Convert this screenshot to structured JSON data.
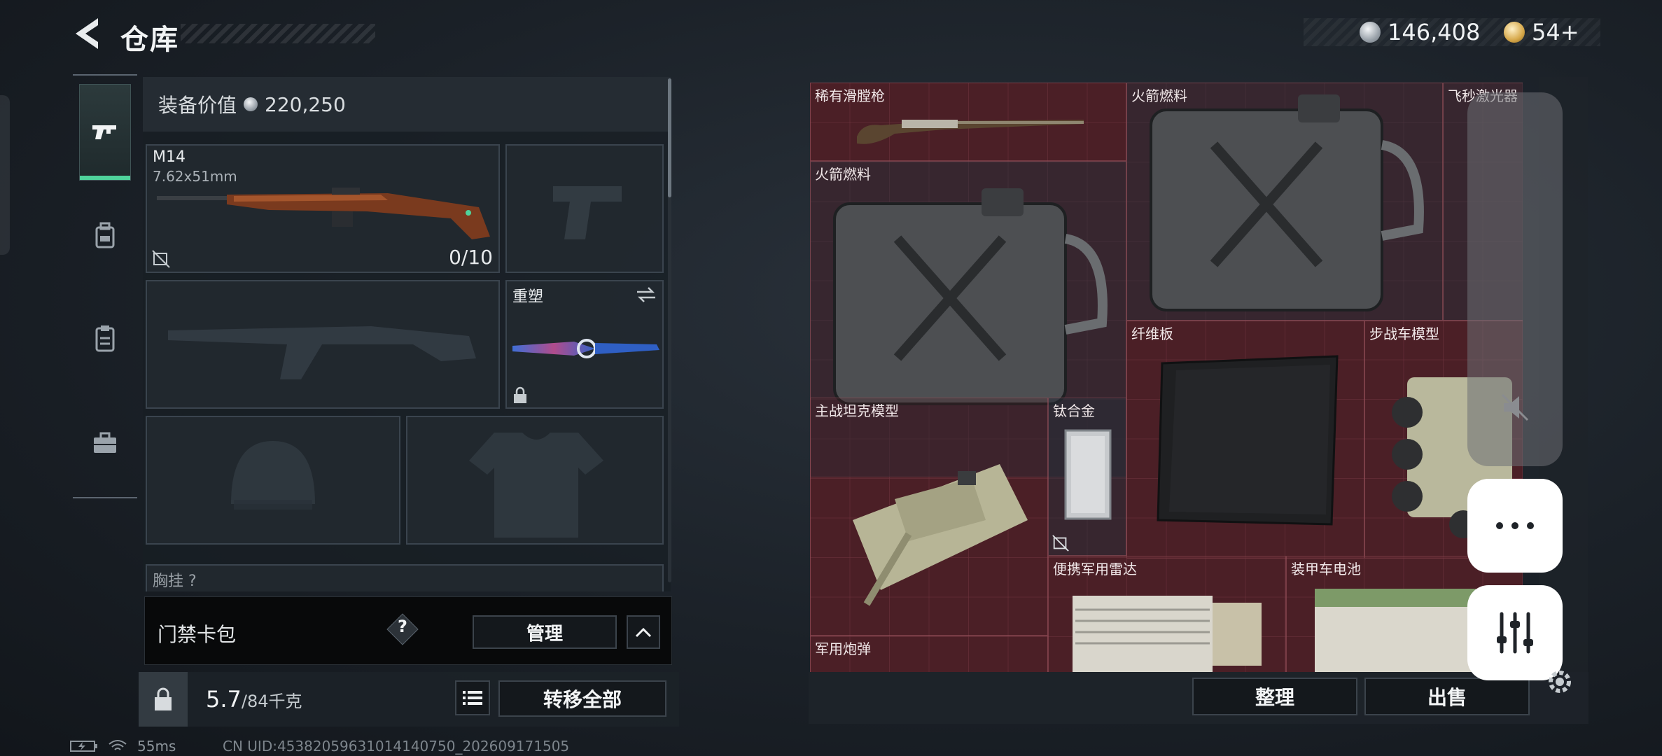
{
  "header": {
    "title": "仓库",
    "currencies": [
      {
        "icon": "silver-coin-icon",
        "amount": "146,408"
      },
      {
        "icon": "gold-coin-icon",
        "amount": "54+"
      }
    ]
  },
  "nav": {
    "items": [
      {
        "name": "weapons",
        "icon": "pistol-icon",
        "active": true
      },
      {
        "name": "armor",
        "icon": "backpack-icon",
        "active": false
      },
      {
        "name": "clipboard",
        "icon": "clipboard-icon",
        "active": false
      },
      {
        "name": "case",
        "icon": "briefcase-icon",
        "active": false
      }
    ]
  },
  "equipment": {
    "value_label": "装备价值",
    "value": "220,250",
    "primary_weapon": {
      "name": "M14",
      "caliber": "7.62x51mm",
      "ammo": "0/10"
    },
    "melee": {
      "name": "重塑"
    },
    "partial_label": "胸挂 ?"
  },
  "access_card": {
    "label": "门禁卡包",
    "help": "?",
    "manage_label": "管理"
  },
  "weight": {
    "current": "5.7",
    "capacity": "/84千克",
    "transfer_all_label": "转移全部"
  },
  "stash": {
    "items": [
      {
        "name": "稀有滑膛枪"
      },
      {
        "name": "火箭燃料"
      },
      {
        "name": "飞秒激光器"
      },
      {
        "name": "火箭燃料"
      },
      {
        "name": "纤维板"
      },
      {
        "name": "步战车模型"
      },
      {
        "name": "主战坦克模型"
      },
      {
        "name": "钛合金"
      },
      {
        "name": "便携军用雷达"
      },
      {
        "name": "装甲车电池"
      },
      {
        "name": "军用炮弹"
      }
    ],
    "sort_label": "整理",
    "sell_label": "出售"
  },
  "status": {
    "ping": "55ms",
    "uid": "CN UID:45382059631014140750_202609171505"
  },
  "colors": {
    "accent": "#4fd39b",
    "stash_bg": "#4a2027",
    "panel_bg": "#1b2128"
  }
}
